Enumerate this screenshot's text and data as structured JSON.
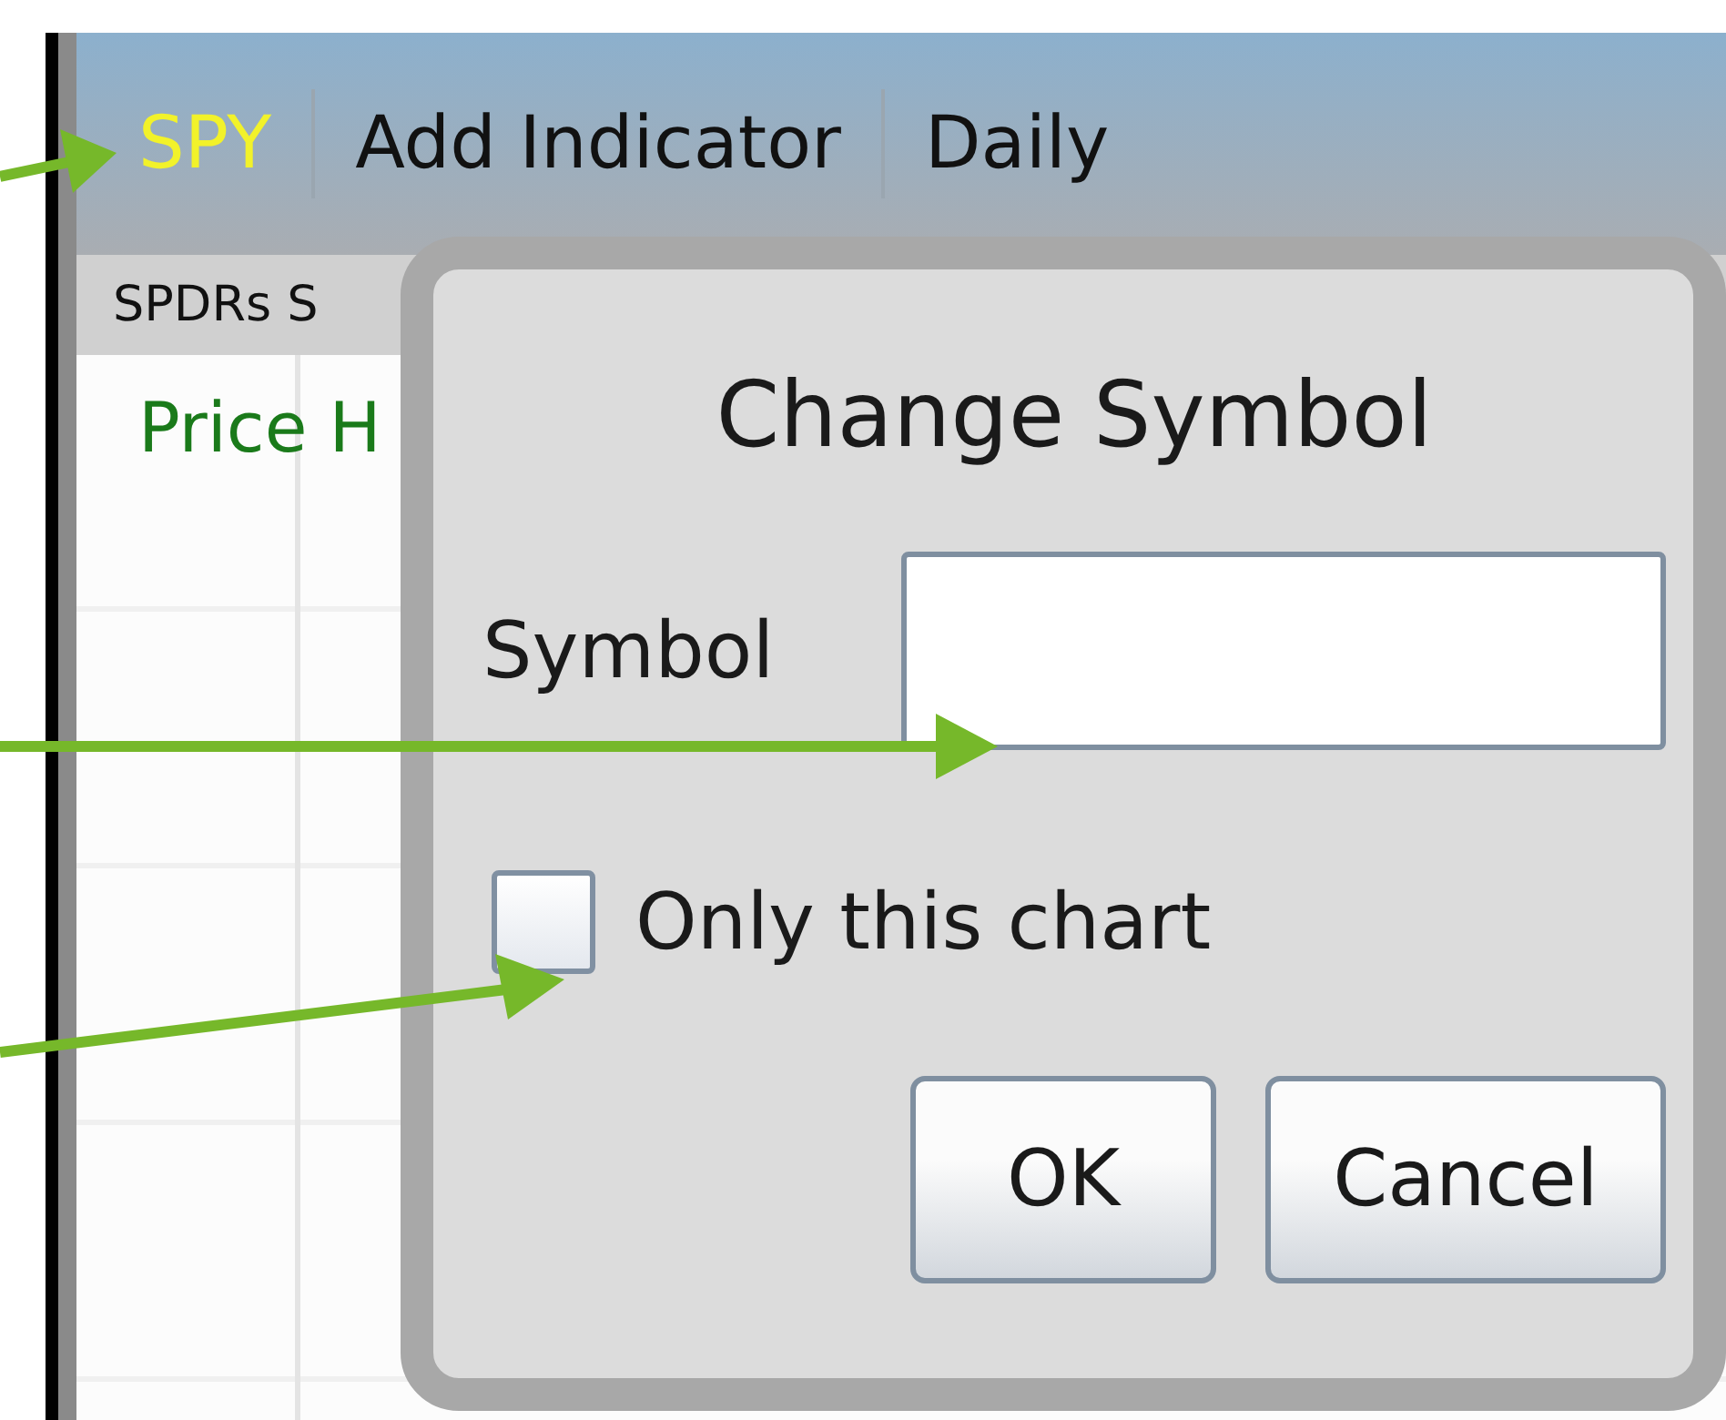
{
  "toolbar": {
    "items": [
      {
        "label": "SPY",
        "selected": true
      },
      {
        "label": "Add Indicator",
        "selected": false
      },
      {
        "label": "Daily",
        "selected": false
      }
    ]
  },
  "subtitle": "SPDRs S",
  "chart": {
    "title": "Price H"
  },
  "dialog": {
    "title": "Change Symbol",
    "field": {
      "label": "Symbol"
    },
    "checkbox": {
      "label": "Only this chart",
      "checked": false
    },
    "buttons": [
      "OK",
      "Cancel"
    ]
  }
}
